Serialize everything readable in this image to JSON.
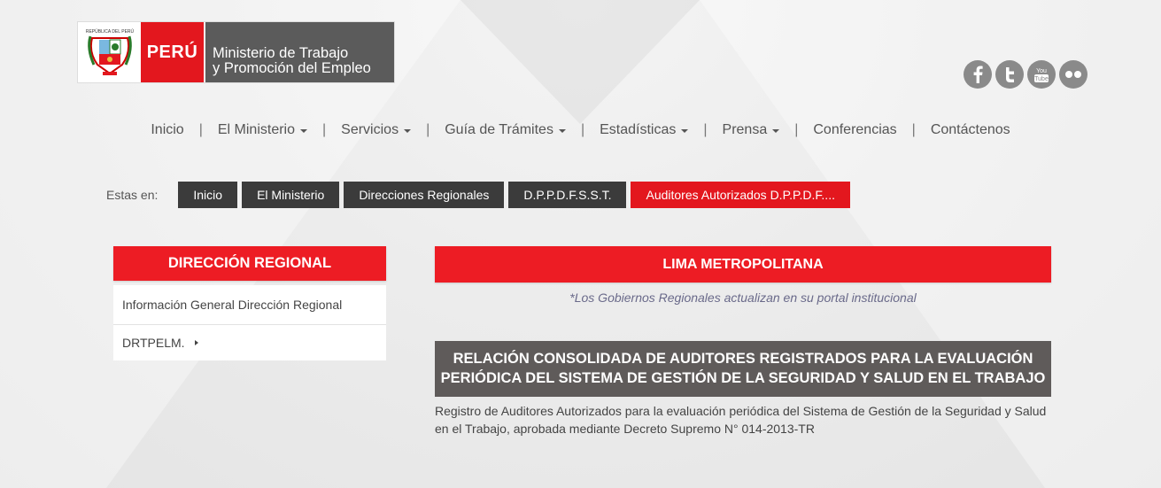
{
  "header": {
    "logo_country": "PERÚ",
    "logo_shield_text": "REPÚBLICA DEL PERÚ",
    "ministry_line1": "Ministerio de Trabajo",
    "ministry_line2": "y Promoción del Empleo"
  },
  "social": [
    {
      "name": "facebook-icon",
      "glyph": "f"
    },
    {
      "name": "twitter-icon",
      "glyph": "t"
    },
    {
      "name": "youtube-icon",
      "glyph": "You Tube"
    },
    {
      "name": "flickr-icon",
      "glyph": "••"
    }
  ],
  "nav": {
    "inicio": "Inicio",
    "ministerio": "El Ministerio",
    "servicios": "Servicios",
    "tramites": "Guía de Trámites",
    "estadisticas": "Estadísticas",
    "prensa": "Prensa",
    "conferencias": "Conferencias",
    "contactenos": "Contáctenos",
    "separator": "|"
  },
  "breadcrumb": {
    "label": "Estas en:",
    "items": [
      "Inicio",
      "El Ministerio",
      "Direcciones Regionales",
      "D.P.P.D.F.S.S.T.",
      "Auditores Autorizados D.P.P.D.F...."
    ]
  },
  "sidebar": {
    "title": "DIRECCIÓN REGIONAL",
    "items": [
      "Información General Dirección Regional",
      "DRTPELM."
    ]
  },
  "main": {
    "region": "LIMA METROPOLITANA",
    "note": "*Los Gobiernos Regionales actualizan en su portal institucional",
    "title": "RELACIÓN CONSOLIDADA DE AUDITORES REGISTRADOS PARA LA EVALUACIÓN PERIÓDICA DEL SISTEMA DE GESTIÓN DE LA SEGURIDAD Y SALUD EN EL TRABAJO",
    "description": "Registro de Auditores Autorizados para la evaluación periódica del Sistema de Gestión de la Seguridad y Salud en el Trabajo, aprobada mediante Decreto Supremo N° 014-2013-TR"
  },
  "colors": {
    "brand_red": "#e3171e",
    "dark_gray": "#5b5b5b",
    "crumb_dark": "#3b3b3b"
  }
}
